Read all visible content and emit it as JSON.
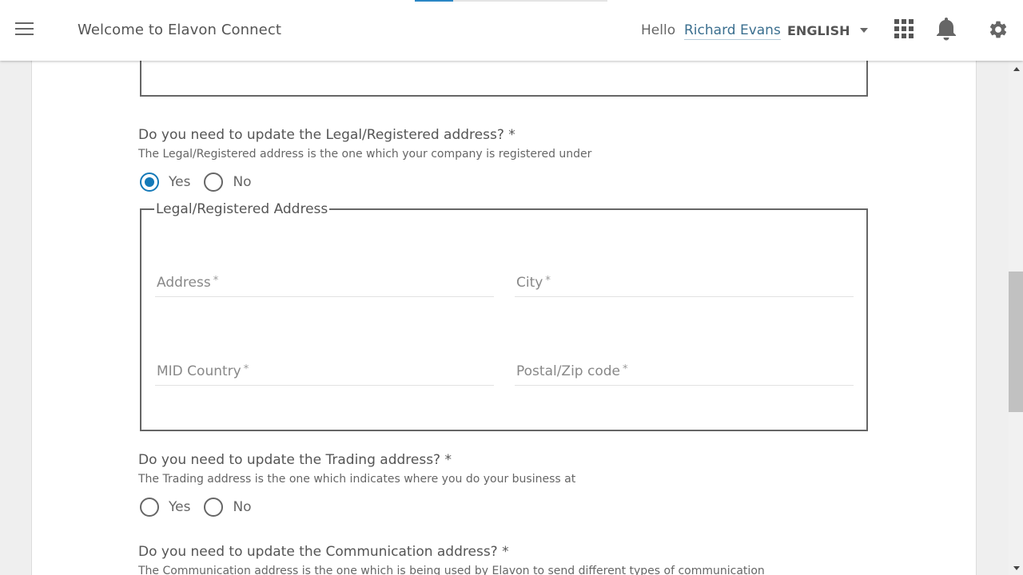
{
  "header": {
    "title": "Welcome to Elavon Connect",
    "greeting": "Hello",
    "user_name": "Richard Evans",
    "language": "ENGLISH",
    "icons": [
      "menu-icon",
      "apps-grid-icon",
      "bell-icon",
      "gear-icon"
    ]
  },
  "loading_progress": {
    "percent": 20,
    "color": "#2a86c5"
  },
  "colors": {
    "accent": "#1479b8",
    "link": "#3b6f8f"
  },
  "form": {
    "legal": {
      "question": "Do you need to update the Legal/Registered address? *",
      "description": "The Legal/Registered address is the one which your company is registered under",
      "options": [
        {
          "label": "Yes",
          "selected": true
        },
        {
          "label": "No",
          "selected": false
        }
      ],
      "fieldset_legend": "Legal/Registered Address",
      "fields": [
        {
          "label": "Address",
          "required": "*",
          "value": ""
        },
        {
          "label": "City",
          "required": "*",
          "value": ""
        },
        {
          "label": "MID Country",
          "required": "*",
          "value": ""
        },
        {
          "label": "Postal/Zip code",
          "required": "*",
          "value": ""
        }
      ]
    },
    "trading": {
      "question": "Do you need to update the Trading address? *",
      "description": "The Trading address is the one which indicates where you do your business at",
      "options": [
        {
          "label": "Yes",
          "selected": false
        },
        {
          "label": "No",
          "selected": false
        }
      ]
    },
    "communication": {
      "question": "Do you need to update the Communication address? *",
      "description": "The Communication address is the one which is being used by Elavon to send different types of communication"
    }
  }
}
